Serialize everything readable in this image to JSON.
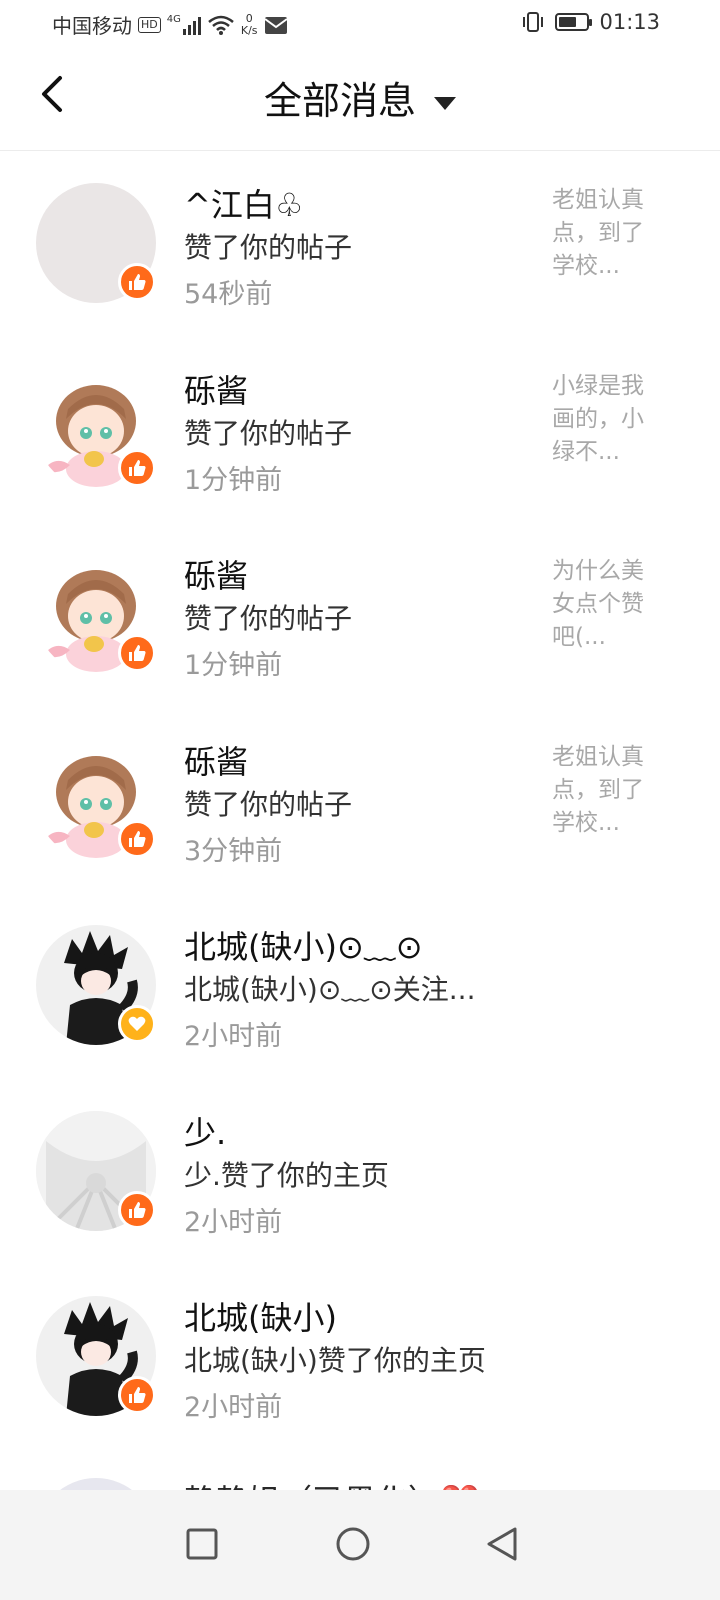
{
  "status_bar": {
    "carrier": "中国移动",
    "hd_badge": "HD",
    "network": "4G",
    "speed_value": "0",
    "speed_unit": "K/s",
    "time": "01:13"
  },
  "header": {
    "title": "全部消息"
  },
  "messages": [
    {
      "name": "^江白♧",
      "action": "赞了你的帖子",
      "time": "54秒前",
      "preview": "老姐认真点，到了学校...",
      "badge": "like",
      "avatar": "blank"
    },
    {
      "name": "砾酱",
      "action": "赞了你的帖子",
      "time": "1分钟前",
      "preview": "小绿是我画的，小绿不...",
      "badge": "like",
      "avatar": "anime"
    },
    {
      "name": "砾酱",
      "action": "赞了你的帖子",
      "time": "1分钟前",
      "preview": "为什么美女点个赞吧(...",
      "badge": "like",
      "avatar": "anime"
    },
    {
      "name": "砾酱",
      "action": "赞了你的帖子",
      "time": "3分钟前",
      "preview": "老姐认真点，到了学校...",
      "badge": "like",
      "avatar": "anime"
    },
    {
      "name": "北城(缺小)⊙﹏⊙",
      "action": "北城(缺小)⊙﹏⊙关注...",
      "time": "2小时前",
      "preview": "",
      "badge": "follow",
      "avatar": "boy"
    },
    {
      "name": "少.",
      "action": "少.赞了你的主页",
      "time": "2小时前",
      "preview": "",
      "badge": "like",
      "avatar": "white"
    },
    {
      "name": "北城(缺小)",
      "action": "北城(缺小)赞了你的主页",
      "time": "2小时前",
      "preview": "",
      "badge": "like",
      "avatar": "boy"
    }
  ],
  "partial_item": {
    "name": "静静姐（已黑化）💔"
  },
  "colors": {
    "like_badge": "#ff6a1a",
    "follow_badge": "#ffb21a"
  }
}
